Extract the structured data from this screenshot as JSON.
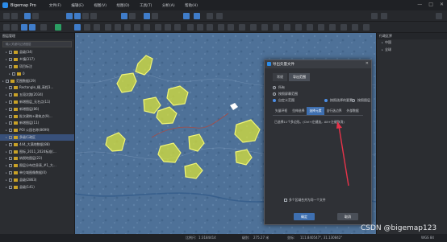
{
  "app": {
    "title": "Bigemap Pro"
  },
  "menu": [
    "文件(F)",
    "编辑(E)",
    "视图(V)",
    "绘图(D)",
    "工具(T)",
    "分析(A)",
    "帮助(H)"
  ],
  "search": {
    "select": "全网搜索",
    "placeholder": "请输入搜索内容",
    "button": "搜索"
  },
  "left_panel": {
    "title": "图层管理",
    "search_placeholder": "输入关键词过滤图层",
    "items": [
      {
        "label": "县级(34)",
        "indent": 1,
        "selected": false
      },
      {
        "label": "乡镇(317)",
        "indent": 1,
        "selected": false
      },
      {
        "label": "项目标注",
        "indent": 1,
        "selected": false
      },
      {
        "label": "0",
        "indent": 2,
        "selected": false
      },
      {
        "label": "范围数据(29)",
        "indent": 0,
        "selected": false
      },
      {
        "label": "Rectangle_栅_高程3...",
        "indent": 1,
        "selected": false
      },
      {
        "label": "五段次路(2034)",
        "indent": 1,
        "selected": false
      },
      {
        "label": "新增图层_无名点(11)",
        "indent": 1,
        "selected": false
      },
      {
        "label": "新增图层(86)",
        "indent": 1,
        "selected": false
      },
      {
        "label": "批次建构+建筑点(9)...",
        "indent": 1,
        "selected": false
      },
      {
        "label": "新增图层(11)",
        "indent": 1,
        "selected": false
      },
      {
        "label": "POI 公园名称(8699)",
        "indent": 1,
        "selected": false
      },
      {
        "label": "多级行政区",
        "indent": 1,
        "selected": true
      },
      {
        "label": "444_大满地数据(88)",
        "indent": 1,
        "selected": false
      },
      {
        "label": "图标_2011_2024标准(...",
        "indent": 1,
        "selected": false
      },
      {
        "label": "纳税地图层(22)",
        "indent": 1,
        "selected": false
      },
      {
        "label": "图层分布信息表_#1_大...",
        "indent": 1,
        "selected": false
      },
      {
        "label": "单位域图像数据(0)",
        "indent": 1,
        "selected": false
      },
      {
        "label": "县级(2863)",
        "indent": 1,
        "selected": false
      },
      {
        "label": "县级(141)",
        "indent": 1,
        "selected": false
      }
    ]
  },
  "right_panel": {
    "title": "行政区界",
    "items": [
      "中国",
      "全球"
    ]
  },
  "dialog": {
    "title": "导出矢量文件",
    "tabs": [
      "常规",
      "导出范围"
    ],
    "radios": [
      {
        "label": "所有",
        "on": false
      },
      {
        "label": "按照屏幕范围",
        "on": false
      },
      {
        "label": "自定义范围",
        "on": true
      },
      {
        "label": "按照选择的要素",
        "on": true
      },
      {
        "label": "按照图层",
        "on": false
      }
    ],
    "format_tabs": [
      "矢量环框",
      "拉伸选择",
      "选择元素",
      "自行选边界",
      "外部数据"
    ],
    "active_format": 3,
    "description": "已选择11个多边形。(Ctrl+左键选，Alt+左键取消)",
    "checkbox_label": "多个区域合并为同一个文件",
    "ok": "确定",
    "cancel": "取消"
  },
  "status": {
    "scale_label": "比例尺:",
    "scale": "1:3184414",
    "level_label": "级别:",
    "level": "275.27 米",
    "coords_label": "坐标:",
    "coords": "111.840547°, 31.130842°",
    "crs": "WGS 84"
  },
  "watermark": "CSDN @bigemap123"
}
